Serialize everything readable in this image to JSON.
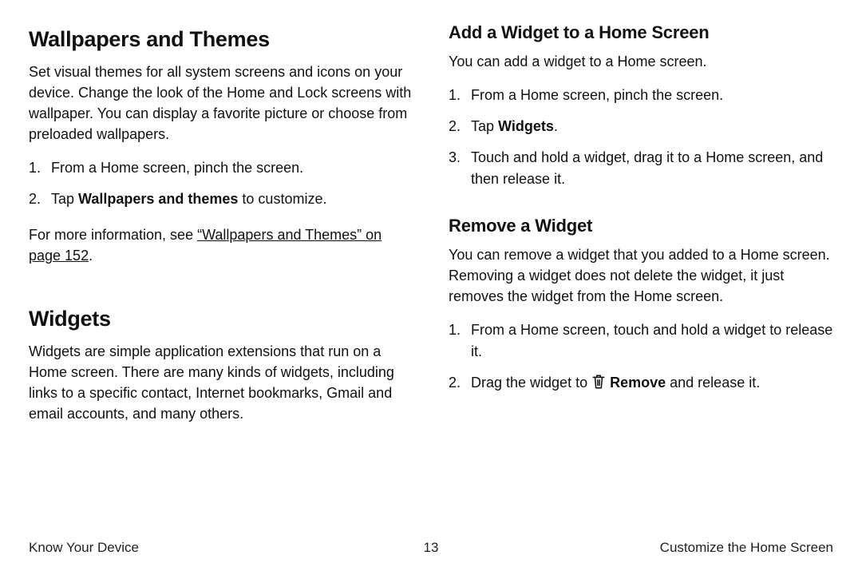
{
  "left": {
    "sec1": {
      "title": "Wallpapers and Themes",
      "para": "Set visual themes for all system screens and icons on your device. Change the look of the Home and Lock screens with wallpaper. You can display a favorite picture or choose from preloaded wallpapers.",
      "step1": "From a Home screen, pinch the screen.",
      "step2_pre": "Tap ",
      "step2_bold": "Wallpapers and themes",
      "step2_post": " to customize.",
      "more_pre": "For more information, see ",
      "more_link": "“Wallpapers and Themes” on page 152",
      "more_post": "."
    },
    "sec2": {
      "title": "Widgets",
      "para": "Widgets are simple application extensions that run on a Home screen. There are many kinds of widgets, including links to a specific contact, Internet bookmarks, Gmail and email accounts, and many others."
    }
  },
  "right": {
    "sub1": {
      "title": "Add a Widget to a Home Screen",
      "para": "You can add a widget to a Home screen.",
      "step1": "From a Home screen, pinch the screen.",
      "step2_pre": "Tap ",
      "step2_bold": "Widgets",
      "step2_post": ".",
      "step3": "Touch and hold a widget, drag it to a Home screen, and then release it."
    },
    "sub2": {
      "title": "Remove a Widget",
      "para": "You can remove a widget that you added to a Home screen. Removing a widget does not delete the widget, it just removes the widget from the Home screen.",
      "step1": "From a Home screen, touch and hold a widget to release it.",
      "step2_pre": "Drag the widget to ",
      "step2_icon": "trash-icon",
      "step2_bold": " Remove",
      "step2_post": " and release it."
    }
  },
  "footer": {
    "left": "Know Your Device",
    "center": "13",
    "right": "Customize the Home Screen"
  }
}
